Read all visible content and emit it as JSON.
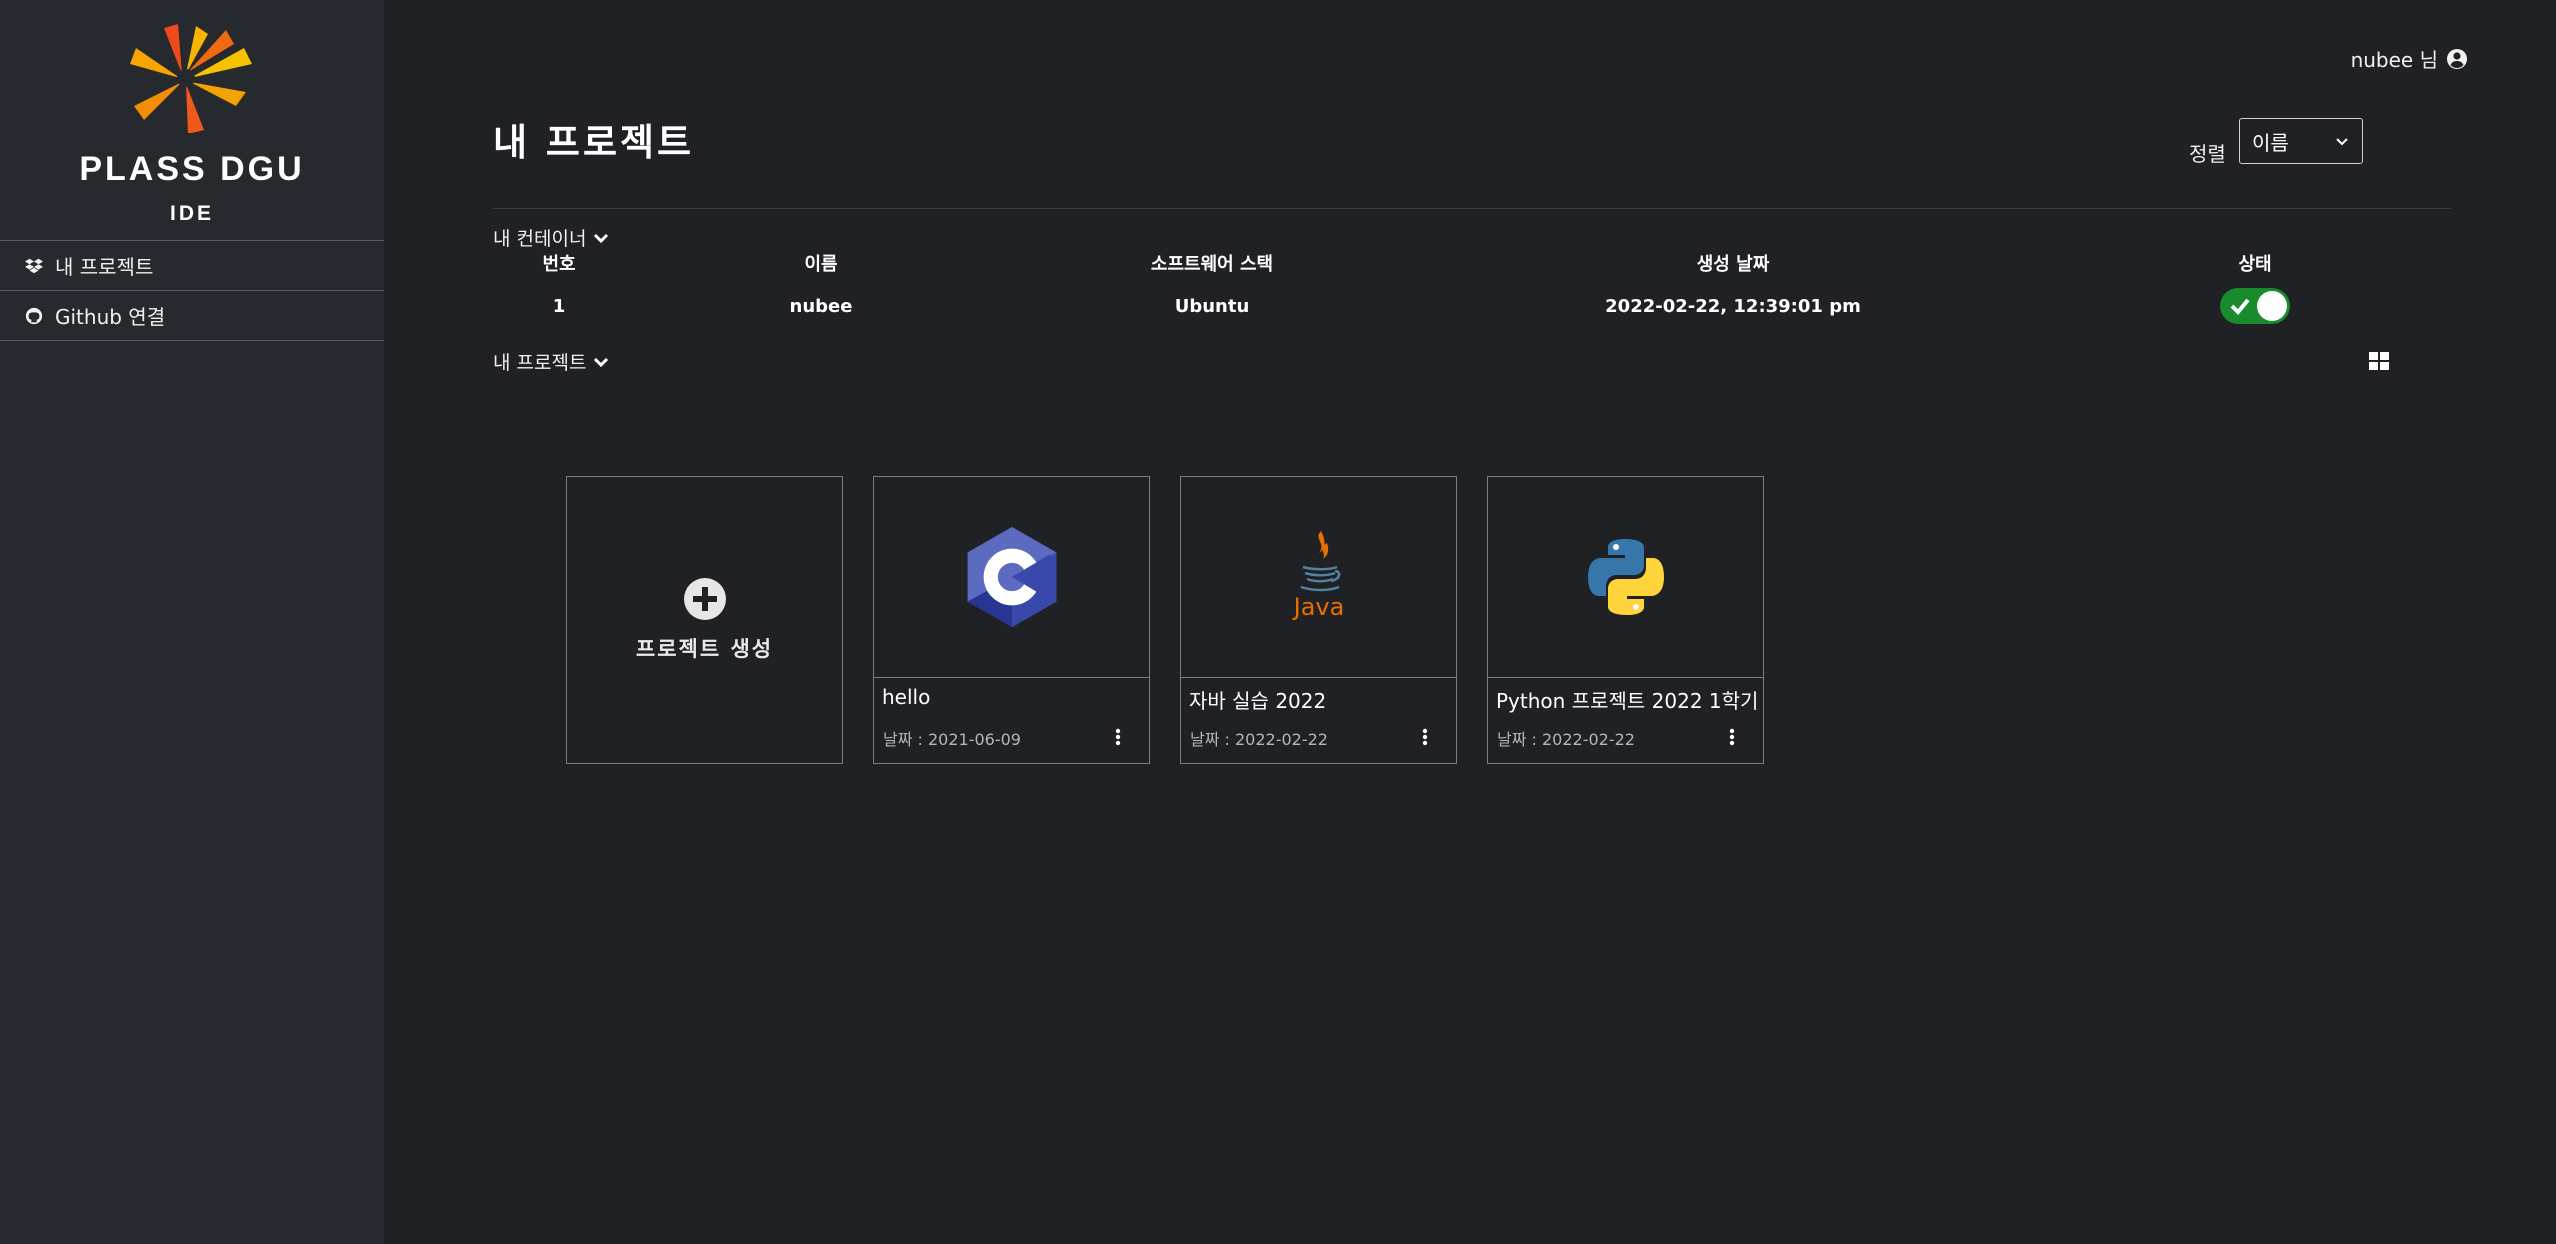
{
  "sidebar": {
    "brand": "PLASS DGU",
    "brand_sub": "IDE",
    "items": [
      {
        "label": "내 프로젝트",
        "icon": "dropbox-icon"
      },
      {
        "label": "Github 연결",
        "icon": "github-icon"
      }
    ]
  },
  "header": {
    "user": "nubee 님",
    "title": "내 프로젝트",
    "sort_label": "정렬",
    "sort_value": "이름"
  },
  "containers": {
    "toggle_label": "내 컨테이너",
    "columns": [
      "번호",
      "이름",
      "소프트웨어 스택",
      "생성 날짜",
      "상태"
    ],
    "rows": [
      {
        "no": "1",
        "name": "nubee",
        "stack": "Ubuntu",
        "created": "2022-02-22, 12:39:01 pm",
        "status_on": true
      }
    ]
  },
  "projects": {
    "toggle_label": "내 프로젝트",
    "create_label": "프로젝트 생성",
    "cards": [
      {
        "name": "hello",
        "date": "날짜 : 2021-06-09",
        "lang": "c-logo"
      },
      {
        "name": "자바 실습 2022",
        "date": "날짜 : 2022-02-22",
        "lang": "java-logo",
        "logo_text": "Java"
      },
      {
        "name": "Python 프로젝트 2022 1학기",
        "date": "날짜 : 2022-02-22",
        "lang": "python-logo"
      }
    ]
  },
  "colors": {
    "background": "#1f2125",
    "sidebar": "#26292d",
    "toggle_on": "#1a8b2d"
  }
}
